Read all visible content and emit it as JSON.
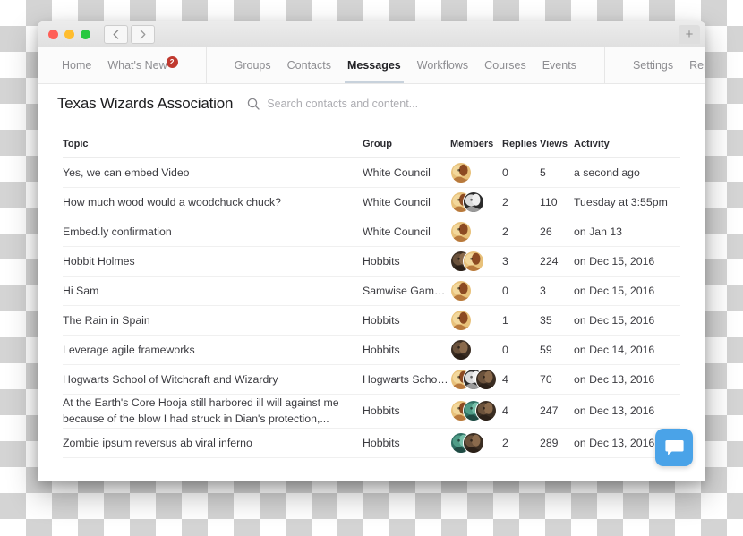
{
  "window": {
    "traffic_lights": [
      "close",
      "minimize",
      "maximize"
    ],
    "back_label": "‹",
    "forward_label": "›",
    "new_tab_label": "+"
  },
  "nav": {
    "primary": [
      {
        "label": "Home",
        "active": false,
        "badge": null
      },
      {
        "label": "What's New",
        "active": false,
        "badge": "2"
      }
    ],
    "secondary": [
      {
        "label": "Groups",
        "active": false
      },
      {
        "label": "Contacts",
        "active": false
      },
      {
        "label": "Messages",
        "active": true
      },
      {
        "label": "Workflows",
        "active": false
      },
      {
        "label": "Courses",
        "active": false
      },
      {
        "label": "Events",
        "active": false
      }
    ],
    "tertiary": [
      {
        "label": "Settings",
        "active": false
      },
      {
        "label": "Reports",
        "active": false
      }
    ]
  },
  "header": {
    "org_title": "Texas Wizards Association",
    "search_placeholder": "Search contacts and content...",
    "search_value": ""
  },
  "table": {
    "columns": [
      "Topic",
      "Group",
      "Members",
      "Replies",
      "Views",
      "Activity"
    ],
    "rows": [
      {
        "topic": "Yes, we can embed Video",
        "group": "White Council",
        "members": [
          "tan"
        ],
        "replies": "0",
        "views": "5",
        "activity": "a second ago"
      },
      {
        "topic": "How much wood would a woodchuck chuck?",
        "group": "White Council",
        "members": [
          "tan",
          "grey"
        ],
        "replies": "2",
        "views": "110",
        "activity": "Tuesday at 3:55pm"
      },
      {
        "topic": "Embed.ly confirmation",
        "group": "White Council",
        "members": [
          "tan"
        ],
        "replies": "2",
        "views": "26",
        "activity": "on Jan 13"
      },
      {
        "topic": "Hobbit Holmes",
        "group": "Hobbits",
        "members": [
          "dark",
          "tan"
        ],
        "replies": "3",
        "views": "224",
        "activity": "on Dec 15, 2016"
      },
      {
        "topic": "Hi Sam",
        "group": "Samwise Gamgee",
        "members": [
          "tan"
        ],
        "replies": "0",
        "views": "3",
        "activity": "on Dec 15, 2016"
      },
      {
        "topic": "The Rain in Spain",
        "group": "Hobbits",
        "members": [
          "tan"
        ],
        "replies": "1",
        "views": "35",
        "activity": "on Dec 15, 2016"
      },
      {
        "topic": "Leverage agile frameworks",
        "group": "Hobbits",
        "members": [
          "dark"
        ],
        "replies": "0",
        "views": "59",
        "activity": "on Dec 14, 2016"
      },
      {
        "topic": "Hogwarts School of Witchcraft and Wizardry",
        "group": "Hogwarts School of...",
        "members": [
          "tan",
          "grey",
          "dark"
        ],
        "replies": "4",
        "views": "70",
        "activity": "on Dec 13, 2016"
      },
      {
        "topic": "At the Earth's Core Hooja still harbored ill will against me because of the blow I had struck in Dian's protection,...",
        "group": "Hobbits",
        "members": [
          "tan",
          "teal",
          "dark"
        ],
        "replies": "4",
        "views": "247",
        "activity": "on Dec 13, 2016"
      },
      {
        "topic": "Zombie ipsum reversus ab viral inferno",
        "group": "Hobbits",
        "members": [
          "teal",
          "dark"
        ],
        "replies": "2",
        "views": "289",
        "activity": "on Dec 13, 2016"
      }
    ]
  },
  "fab": {
    "icon": "chat-bubble-icon",
    "color": "#4aa3e8"
  },
  "colors": {
    "badge": "#c0392f",
    "active_tab_underline": "#c8d2dc",
    "fab": "#4aa3e8"
  }
}
